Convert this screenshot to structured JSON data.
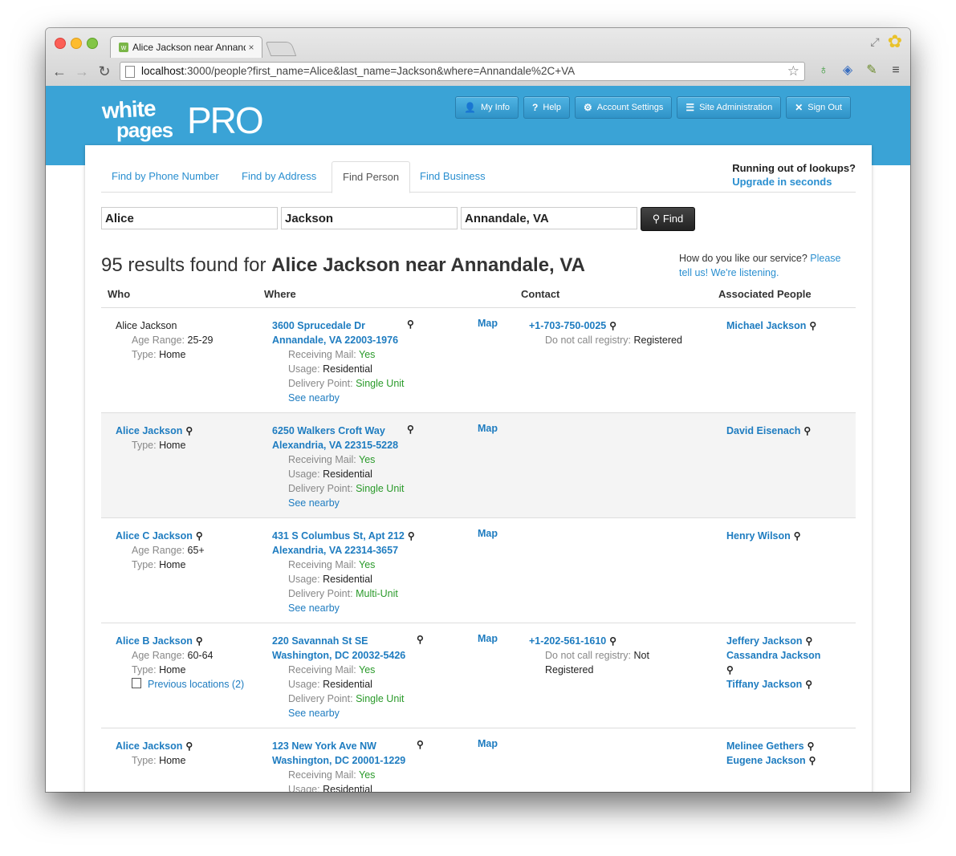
{
  "browser": {
    "tab_title": "Alice Jackson near Annand",
    "tab_close": "×",
    "url_host": "localhost",
    "url_rest": ":3000/people?first_name=Alice&last_name=Jackson&where=Annandale%2C+VA",
    "back": "←",
    "forward": "→",
    "reload": "↻",
    "star": "☆",
    "favicon": "w"
  },
  "logo": {
    "white": "white",
    "pages": "pages",
    "pro": "PRO"
  },
  "top_nav": {
    "my_info": "My Info",
    "help": "Help",
    "account_settings": "Account Settings",
    "site_admin": "Site Administration",
    "sign_out": "Sign Out"
  },
  "find_tabs": [
    "Find by Phone Number",
    "Find by Address",
    "Find Person",
    "Find Business"
  ],
  "promo": {
    "question": "Running out of lookups?",
    "link": "Upgrade in seconds"
  },
  "search": {
    "first_name": "Alice",
    "last_name": "Jackson",
    "where": "Annandale, VA",
    "find_label": "Find"
  },
  "results": {
    "prefix": "95 results found for ",
    "query": "Alice Jackson near Annandale, VA"
  },
  "feedback": {
    "text": "How do you like our service? ",
    "link1": "Please",
    "link2": "tell us! We're listening."
  },
  "columns": {
    "who": "Who",
    "where": "Where",
    "contact": "Contact",
    "assoc": "Associated People"
  },
  "labels": {
    "age_range": "Age Range:",
    "type": "Type:",
    "receiving_mail": "Receiving Mail:",
    "usage": "Usage:",
    "delivery_point": "Delivery Point:",
    "see_nearby": "See nearby",
    "map": "Map",
    "dnc": "Do not call registry:"
  },
  "rows": [
    {
      "name": "Alice Jackson",
      "age": "25-29",
      "type": "Home",
      "addr1": "3600 Sprucedale Dr",
      "addr2": "Annandale, VA 22003-1976",
      "mail": "Yes",
      "usage": "Residential",
      "delivery": "Single Unit",
      "phone": "+1-703-750-0025",
      "dnc": "Registered",
      "assoc": [
        "Michael Jackson"
      ]
    },
    {
      "name": "Alice Jackson",
      "type": "Home",
      "addr1": "6250 Walkers Croft Way",
      "addr2": "Alexandria, VA 22315-5228",
      "mail": "Yes",
      "usage": "Residential",
      "delivery": "Single Unit",
      "assoc": [
        "David Eisenach"
      ]
    },
    {
      "name": "Alice C Jackson",
      "age": "65+",
      "type": "Home",
      "addr1": "431 S Columbus St, Apt 212",
      "addr2": "Alexandria, VA 22314-3657",
      "mail": "Yes",
      "usage": "Residential",
      "delivery": "Multi-Unit",
      "assoc": [
        "Henry Wilson"
      ]
    },
    {
      "name": "Alice B Jackson",
      "age": "60-64",
      "type": "Home",
      "prev": "Previous locations (2)",
      "addr1": "220 Savannah St SE",
      "addr2": "Washington, DC 20032-5426",
      "mail": "Yes",
      "usage": "Residential",
      "delivery": "Single Unit",
      "phone": "+1-202-561-1610",
      "dnc1": "Not",
      "dnc2": "Registered",
      "assoc": [
        "Jeffery Jackson",
        "Cassandra Jackson",
        "Tiffany Jackson"
      ]
    },
    {
      "name": "Alice Jackson",
      "type": "Home",
      "addr1": "123 New York Ave NW",
      "addr2": "Washington, DC 20001-1229",
      "mail": "Yes",
      "usage": "Residential",
      "assoc": [
        "Melinee Gethers",
        "Eugene Jackson"
      ]
    }
  ]
}
